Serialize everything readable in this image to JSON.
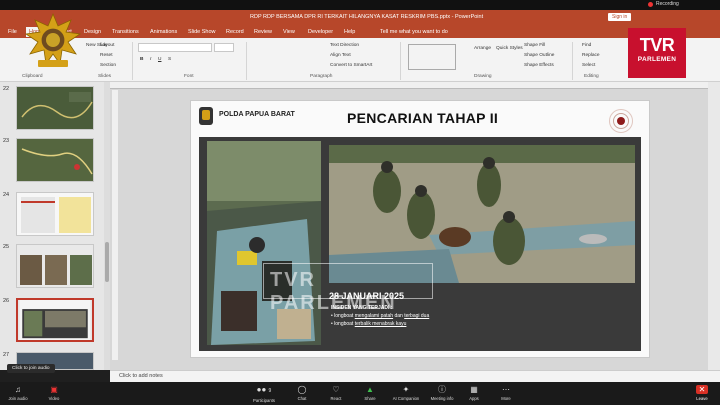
{
  "window": {
    "title": "RDP RDP BERSAMA DPR RI TERKAIT HILANGNYA KASAT RESKRIM PBS.pptx - PowerPoint",
    "sign_in": "Sign in",
    "recording": "Recording"
  },
  "menu": {
    "tabs": [
      "File",
      "Home",
      "Insert",
      "Design",
      "Transitions",
      "Animations",
      "Slide Show",
      "Record",
      "Review",
      "View",
      "Developer",
      "Help",
      "Tell me what you want to do"
    ]
  },
  "ribbon": {
    "groups": [
      "Clipboard",
      "Slides",
      "Font",
      "Paragraph",
      "Drawing",
      "Editing"
    ],
    "slides_buttons": [
      "New Slide",
      "Layout",
      "Reset",
      "Section"
    ],
    "paragraph_buttons": [
      "Text Direction",
      "Align Text",
      "Convert to SmartArt"
    ],
    "drawing_buttons": [
      "Arrange",
      "Quick Styles",
      "Shape Fill",
      "Shape Outline",
      "Shape Effects"
    ],
    "editing_buttons": [
      "Find",
      "Replace",
      "Select"
    ]
  },
  "logo": {
    "brand": "TVR",
    "sub": "PARLEMEN"
  },
  "thumbnails": {
    "numbers": [
      "22",
      "23",
      "24",
      "25",
      "26",
      "27"
    ],
    "active_index": 4
  },
  "slide": {
    "org": "POLDA PAPUA BARAT",
    "title": "PENCARIAN TAHAP II",
    "date": "28 JANUARI 2025",
    "incident_heading": "INSIDEN YANG TERJADI :",
    "bullets": [
      {
        "pre": "longboat ",
        "u": "mengalami patah",
        "mid": " dan ",
        "u2": "terbagi dua"
      },
      {
        "pre": "longboat ",
        "u": "terbalik menabrak kayu",
        "mid": "",
        "u2": ""
      }
    ],
    "watermark": "TVR PARLEMEN"
  },
  "notes": {
    "placeholder": "Click to add notes"
  },
  "tooltip": "Click to join audio",
  "zoom_toolbar": {
    "items": [
      "Join audio",
      "Video",
      "Participants",
      "Chat",
      "React",
      "Share",
      "AI Companion",
      "Meeting info",
      "Apps",
      "More",
      "Leave"
    ],
    "participants_count": "9"
  }
}
